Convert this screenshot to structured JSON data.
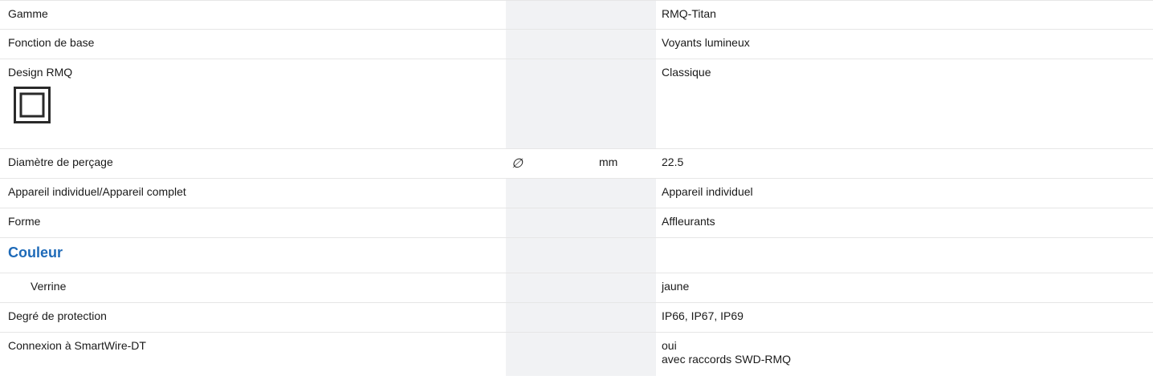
{
  "rows": [
    {
      "label": "Gamme",
      "symbol": "",
      "unit": "",
      "value": "RMQ-Titan"
    },
    {
      "label": "Fonction de base",
      "symbol": "",
      "unit": "",
      "value": "Voyants lumineux"
    },
    {
      "label": "Design RMQ",
      "symbol": "",
      "unit": "",
      "value": "Classique",
      "icon": "double-square-design-icon"
    },
    {
      "label": "Diamètre de perçage",
      "symbol": "∅",
      "unit": "mm",
      "value": "22.5"
    },
    {
      "label": "Appareil individuel/Appareil complet",
      "symbol": "",
      "unit": "",
      "value": "Appareil individuel"
    },
    {
      "label": "Forme",
      "symbol": "",
      "unit": "",
      "value": "Affleurants"
    },
    {
      "label": "Couleur",
      "symbol": "",
      "unit": "",
      "value": "",
      "is_heading": true,
      "color": "#1e6ab8"
    },
    {
      "label": "Verrine",
      "symbol": "",
      "unit": "",
      "value": "jaune",
      "indent": true
    },
    {
      "label": "Degré de protection",
      "symbol": "",
      "unit": "",
      "value": "IP66, IP67, IP69"
    },
    {
      "label": "Connexion à SmartWire-DT",
      "symbol": "",
      "unit": "",
      "value_lines": [
        "oui",
        "avec raccords SWD-RMQ"
      ]
    }
  ]
}
